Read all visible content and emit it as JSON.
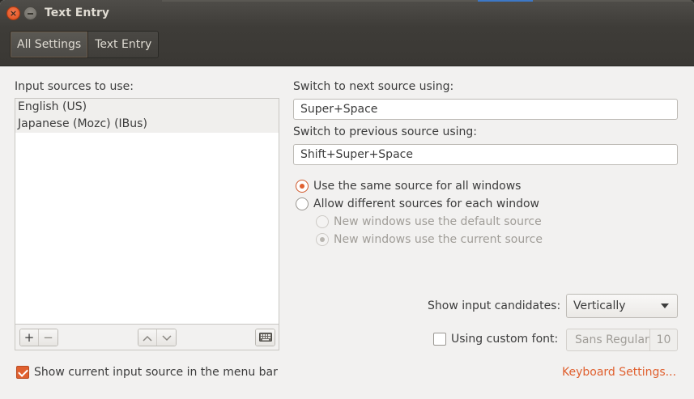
{
  "window": {
    "title": "Text Entry"
  },
  "breadcrumbs": [
    {
      "label": "All Settings",
      "active": true
    },
    {
      "label": "Text Entry",
      "active": false
    }
  ],
  "input_sources": {
    "heading": "Input sources to use:",
    "items": [
      "English (US)",
      "Japanese (Mozc) (IBus)"
    ],
    "toolbar": {
      "add": "+",
      "remove": "−",
      "up": "∧",
      "down": "∨"
    }
  },
  "shortcuts": {
    "next_label": "Switch to next source using:",
    "next_value": "Super+Space",
    "prev_label": "Switch to previous source using:",
    "prev_value": "Shift+Super+Space"
  },
  "source_mode": {
    "same_label": "Use the same source for all windows",
    "same_selected": true,
    "different_label": "Allow different sources for each window",
    "default_label": "New windows use the default source",
    "current_label": "New windows use the current source",
    "current_selected": true
  },
  "candidates": {
    "label": "Show input candidates:",
    "value": "Vertically"
  },
  "custom_font": {
    "label": "Using custom font:",
    "checked": false,
    "font_name": "Sans Regular",
    "font_size": "10"
  },
  "menu_bar": {
    "label": "Show current input source in the menu bar",
    "checked": true
  },
  "keyboard_link": "Keyboard Settings...",
  "colors": {
    "accent": "#e0602f",
    "titlebar": "#3e3c38",
    "background": "#f2f1f0"
  }
}
